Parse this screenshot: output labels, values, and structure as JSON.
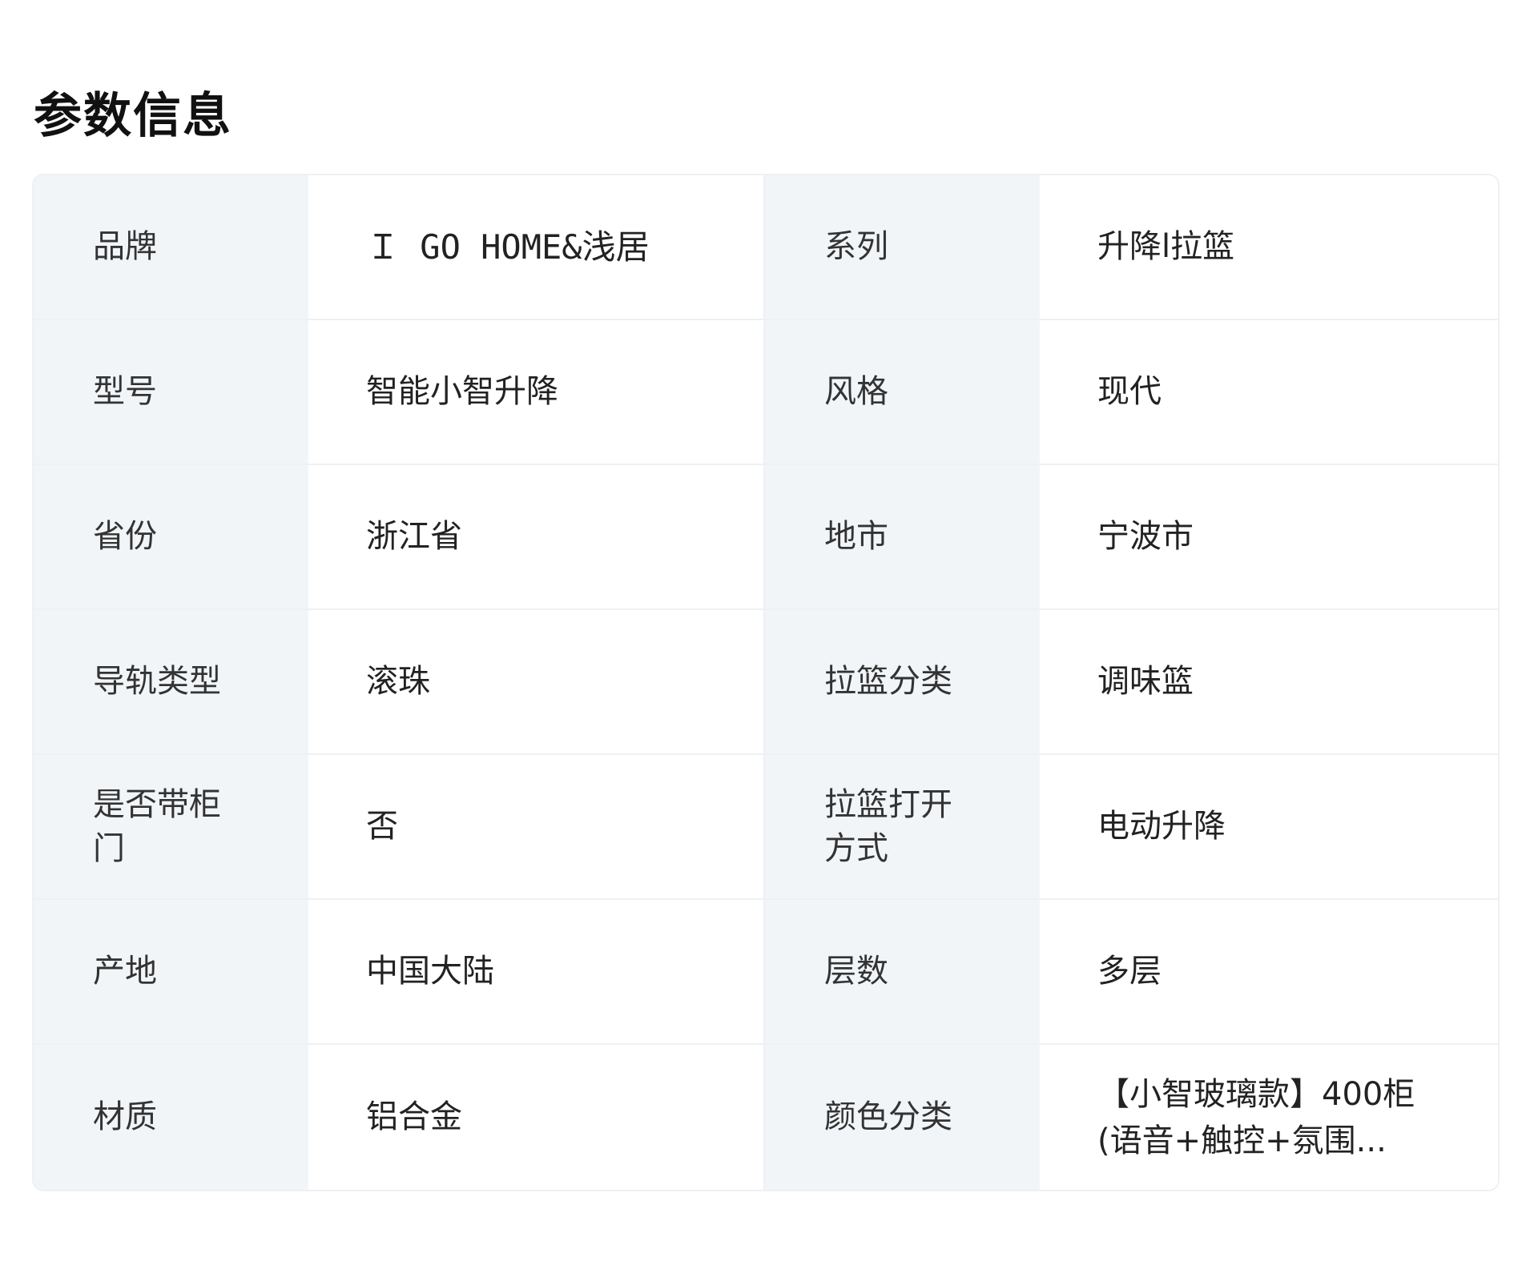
{
  "section": {
    "title": "参数信息"
  },
  "params": [
    {
      "label1": "品牌",
      "value1": "Ｉ GO HOME&浅居",
      "label2": "系列",
      "value2": "升降l拉篮"
    },
    {
      "label1": "型号",
      "value1": "智能小智升降",
      "label2": "风格",
      "value2": "现代"
    },
    {
      "label1": "省份",
      "value1": "浙江省",
      "label2": "地市",
      "value2": "宁波市"
    },
    {
      "label1": "导轨类型",
      "value1": "滚珠",
      "label2": "拉篮分类",
      "value2": "调味篮"
    },
    {
      "label1": "是否带柜门",
      "value1": "否",
      "label2": "拉篮打开方式",
      "value2": "电动升降"
    },
    {
      "label1": "产地",
      "value1": "中国大陆",
      "label2": "层数",
      "value2": "多层"
    },
    {
      "label1": "材质",
      "value1": "铝合金",
      "label2": "颜色分类",
      "value2": "【小智玻璃款】400柜(语音+触控+氛围..."
    }
  ]
}
